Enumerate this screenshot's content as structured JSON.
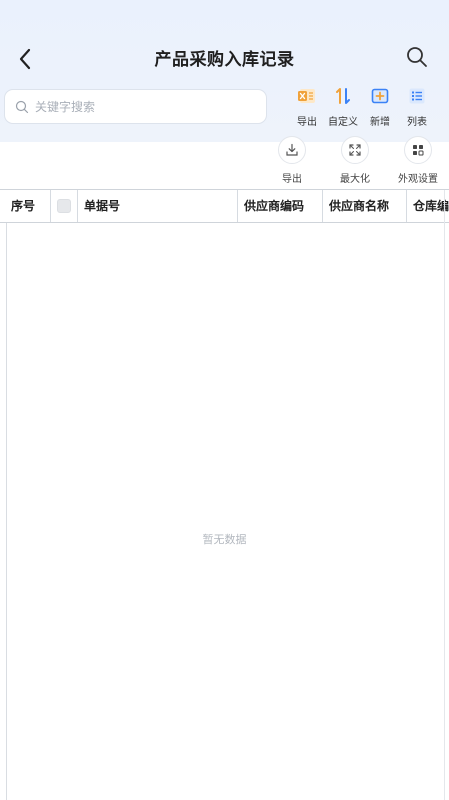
{
  "header": {
    "title": "产品采购入库记录"
  },
  "search": {
    "placeholder": "关键字搜索",
    "value": ""
  },
  "toolbar": {
    "items": [
      {
        "label": "导出",
        "icon": "excel-export-icon",
        "color": "#f0a23a"
      },
      {
        "label": "自定义",
        "icon": "sort-arrows-icon",
        "color": "#f0a23a"
      },
      {
        "label": "新增",
        "icon": "add-box-icon",
        "color": "#3b82f6"
      },
      {
        "label": "列表",
        "icon": "list-icon",
        "color": "#3b82f6"
      }
    ]
  },
  "actions": {
    "items": [
      {
        "label": "导出",
        "icon": "download-icon"
      },
      {
        "label": "最大化",
        "icon": "maximize-icon"
      },
      {
        "label": "外观设置",
        "icon": "grid-settings-icon"
      }
    ]
  },
  "table": {
    "columns": [
      "序号",
      "",
      "单据号",
      "供应商编码",
      "供应商名称",
      "仓库编"
    ],
    "rows": [],
    "empty_text": "暂无数据"
  }
}
